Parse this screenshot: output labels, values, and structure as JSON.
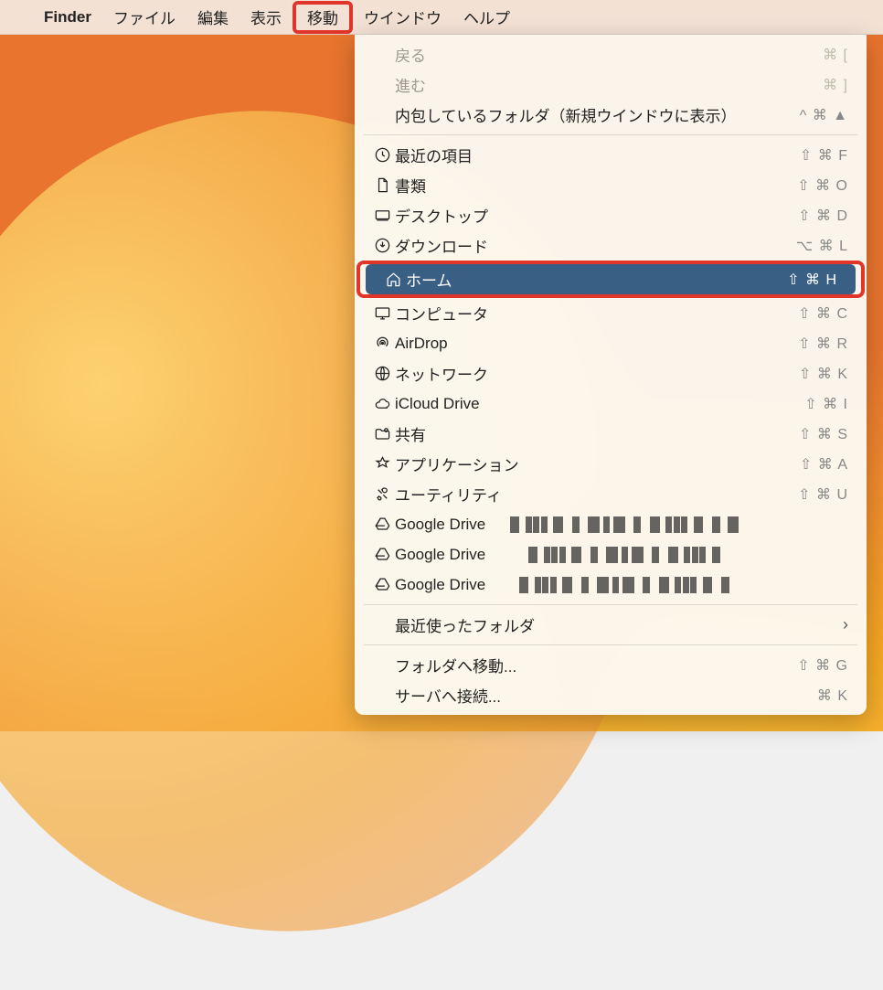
{
  "menubar": {
    "app_name": "Finder",
    "items": [
      "ファイル",
      "編集",
      "表示",
      "移動",
      "ウインドウ",
      "ヘルプ"
    ],
    "active_index": 3
  },
  "menu": {
    "back": {
      "label": "戻る",
      "shortcut": "⌘ [",
      "disabled": true
    },
    "forward": {
      "label": "進む",
      "shortcut": "⌘ ]",
      "disabled": true
    },
    "enclosing": {
      "label": "内包しているフォルダ（新規ウインドウに表示）",
      "shortcut": "^ ⌘ ▲"
    },
    "recents": {
      "label": "最近の項目",
      "shortcut": "⇧ ⌘ F"
    },
    "documents": {
      "label": "書類",
      "shortcut": "⇧ ⌘ O"
    },
    "desktop": {
      "label": "デスクトップ",
      "shortcut": "⇧ ⌘ D"
    },
    "downloads": {
      "label": "ダウンロード",
      "shortcut": "⌥ ⌘ L"
    },
    "home": {
      "label": "ホーム",
      "shortcut": "⇧ ⌘ H",
      "selected": true
    },
    "computer": {
      "label": "コンピュータ",
      "shortcut": "⇧ ⌘ C"
    },
    "airdrop": {
      "label": "AirDrop",
      "shortcut": "⇧ ⌘ R"
    },
    "network": {
      "label": "ネットワーク",
      "shortcut": "⇧ ⌘ K"
    },
    "icloud": {
      "label": "iCloud Drive",
      "shortcut": "⇧ ⌘ I"
    },
    "shared": {
      "label": "共有",
      "shortcut": "⇧ ⌘ S"
    },
    "applications": {
      "label": "アプリケーション",
      "shortcut": "⇧ ⌘ A"
    },
    "utilities": {
      "label": "ユーティリティ",
      "shortcut": "⇧ ⌘ U"
    },
    "gdrive1": {
      "label": "Google Drive"
    },
    "gdrive2": {
      "label": "Google Drive"
    },
    "gdrive3": {
      "label": "Google Drive"
    },
    "recent_folders": {
      "label": "最近使ったフォルダ"
    },
    "go_to_folder": {
      "label": "フォルダへ移動...",
      "shortcut": "⇧ ⌘ G"
    },
    "connect_server": {
      "label": "サーバへ接続...",
      "shortcut": "⌘ K"
    }
  }
}
